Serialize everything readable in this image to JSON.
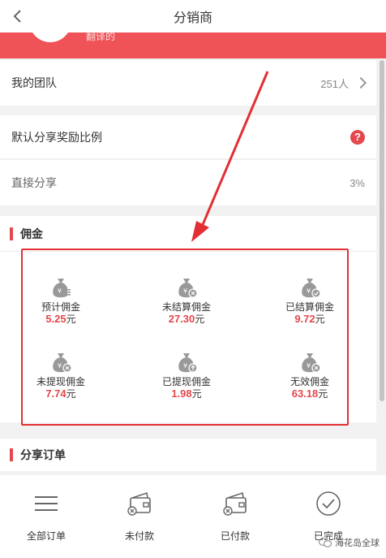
{
  "nav": {
    "title": "分销商",
    "back_icon": "chevron-left-icon"
  },
  "banner": {
    "name": "翻译的"
  },
  "team": {
    "label": "我的团队",
    "value": "251人"
  },
  "ratio": {
    "label": "默认分享奖励比例",
    "help": "?"
  },
  "direct": {
    "label": "直接分享",
    "value": "3%"
  },
  "commission": {
    "title": "佣金",
    "items": [
      {
        "label": "预计佣金",
        "value": "5.25",
        "unit": "元",
        "icon": "money-bag-list-icon"
      },
      {
        "label": "未结算佣金",
        "value": "27.30",
        "unit": "元",
        "icon": "money-bag-x-icon"
      },
      {
        "label": "已结算佣金",
        "value": "9.72",
        "unit": "元",
        "icon": "money-bag-check-icon"
      },
      {
        "label": "未提现佣金",
        "value": "7.74",
        "unit": "元",
        "icon": "money-bag-x-icon"
      },
      {
        "label": "已提现佣金",
        "value": "1.98",
        "unit": "元",
        "icon": "money-bag-up-icon"
      },
      {
        "label": "无效佣金",
        "value": "63.18",
        "unit": "元",
        "icon": "money-bag-x-icon"
      }
    ]
  },
  "orders": {
    "title": "分享订单"
  },
  "tabs": [
    {
      "label": "全部订单",
      "icon": "list-icon"
    },
    {
      "label": "未付款",
      "icon": "wallet-x-icon"
    },
    {
      "label": "已付款",
      "icon": "wallet-x-icon"
    },
    {
      "label": "已完成",
      "icon": "check-circle-icon"
    }
  ],
  "watermark": {
    "text": "海花岛全球"
  },
  "colors": {
    "accent": "#e2484d",
    "banner": "#ef5257",
    "highlight_border": "#e22f33"
  }
}
